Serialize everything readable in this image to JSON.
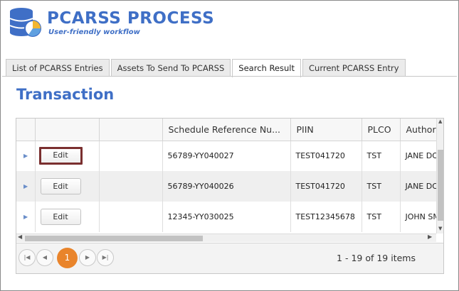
{
  "brand": {
    "title": "PCARSS PROCESS",
    "subtitle": "User-friendly workflow",
    "logo_icon": "database-chart-icon"
  },
  "tabs": [
    {
      "label": "List of PCARSS Entries",
      "active": false
    },
    {
      "label": "Assets To Send To PCARSS",
      "active": false
    },
    {
      "label": "Search Result",
      "active": true
    },
    {
      "label": "Current PCARSS Entry",
      "active": false
    }
  ],
  "section": {
    "title": "Transaction"
  },
  "grid": {
    "columns": [
      "",
      "",
      "",
      "Schedule Reference Nu...",
      "PIIN",
      "PLCO",
      "Author"
    ],
    "rows": [
      {
        "expander_icon": "triangle-right-icon",
        "edit_label": "Edit",
        "schedule_ref": "56789-YY040027",
        "piin": "TEST041720",
        "plco": "TST",
        "author": "JANE DOE"
      },
      {
        "expander_icon": "triangle-right-icon",
        "edit_label": "Edit",
        "schedule_ref": "56789-YY040026",
        "piin": "TEST041720",
        "plco": "TST",
        "author": "JANE DOE"
      },
      {
        "expander_icon": "triangle-right-icon",
        "edit_label": "Edit",
        "schedule_ref": "12345-YY030025",
        "piin": "TEST12345678",
        "plco": "TST",
        "author": "JOHN SMITH"
      }
    ]
  },
  "pager": {
    "current_page": "1",
    "info": "1 - 19 of 19 items",
    "first_icon": "first-page-icon",
    "prev_icon": "prev-page-icon",
    "next_icon": "next-page-icon",
    "last_icon": "last-page-icon"
  },
  "colors": {
    "brand": "#3f6fc6",
    "pager_current": "#e9842b",
    "focus_border": "#7a2f2f"
  }
}
